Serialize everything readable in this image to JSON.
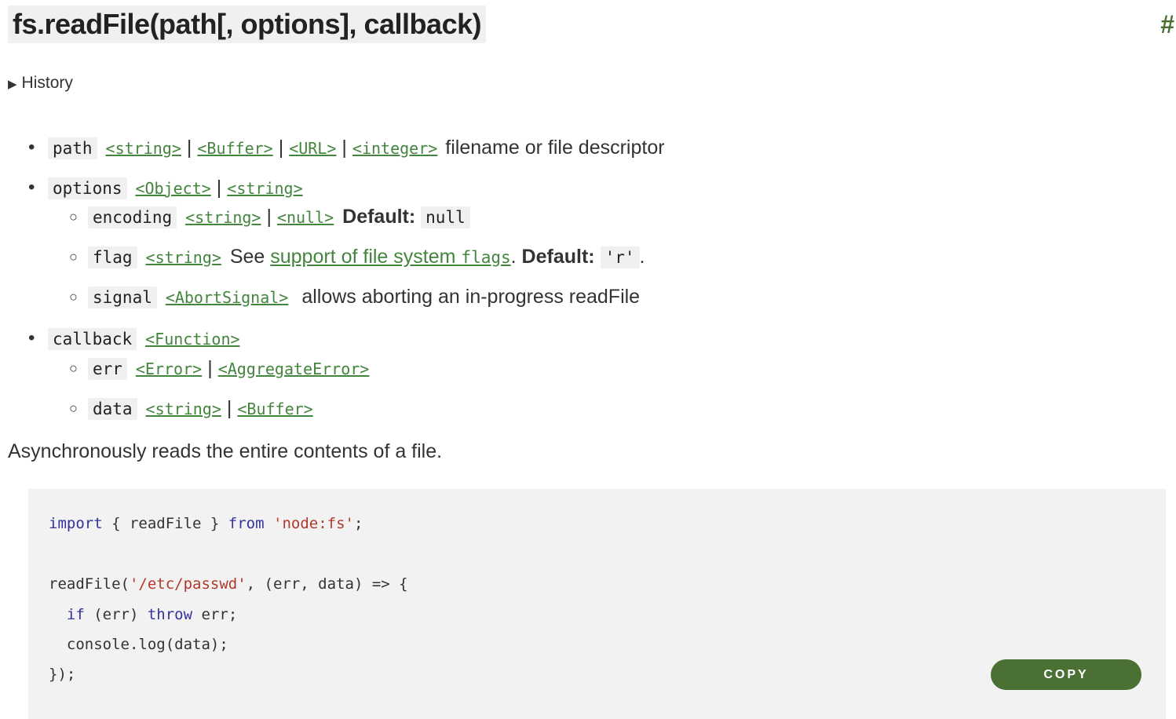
{
  "heading": {
    "title": "fs.readFile(path[, options], callback)",
    "anchor": "#"
  },
  "history": {
    "label": "History"
  },
  "params": {
    "path": {
      "name": "path",
      "types": [
        "<string>",
        "<Buffer>",
        "<URL>",
        "<integer>"
      ],
      "desc": "filename or file descriptor"
    },
    "options": {
      "name": "options",
      "types": [
        "<Object>",
        "<string>"
      ],
      "encoding": {
        "name": "encoding",
        "types": [
          "<string>",
          "<null>"
        ],
        "default_label": "Default:",
        "default_value": "null"
      },
      "flag": {
        "name": "flag",
        "types": [
          "<string>"
        ],
        "see": "See",
        "link_text": "support of file system",
        "link_code": "flags",
        "period1": ".",
        "default_label": "Default:",
        "default_value": "'r'",
        "period2": "."
      },
      "signal": {
        "name": "signal",
        "types": [
          "<AbortSignal>"
        ],
        "desc": "allows aborting an in-progress readFile"
      }
    },
    "callback": {
      "name": "callback",
      "types": [
        "<Function>"
      ],
      "err": {
        "name": "err",
        "types": [
          "<Error>",
          "<AggregateError>"
        ]
      },
      "data": {
        "name": "data",
        "types": [
          "<string>",
          "<Buffer>"
        ]
      }
    },
    "separator": "|"
  },
  "description": "Asynchronously reads the entire contents of a file.",
  "code": {
    "l1": {
      "kw1": "import",
      "t1": " { readFile } ",
      "kw2": "from",
      "sp": " ",
      "s1": "'node:fs'",
      "t2": ";"
    },
    "l2": {
      "t1": "readFile(",
      "s1": "'/etc/passwd'",
      "t2": ", (err, data) => {"
    },
    "l3": {
      "ind": "  ",
      "kw1": "if",
      "t1": " (err) ",
      "kw2": "throw",
      "t2": " err;"
    },
    "l4": {
      "t1": "  console.log(data);"
    },
    "l5": {
      "t1": "});"
    },
    "copy_label": "COPY"
  }
}
